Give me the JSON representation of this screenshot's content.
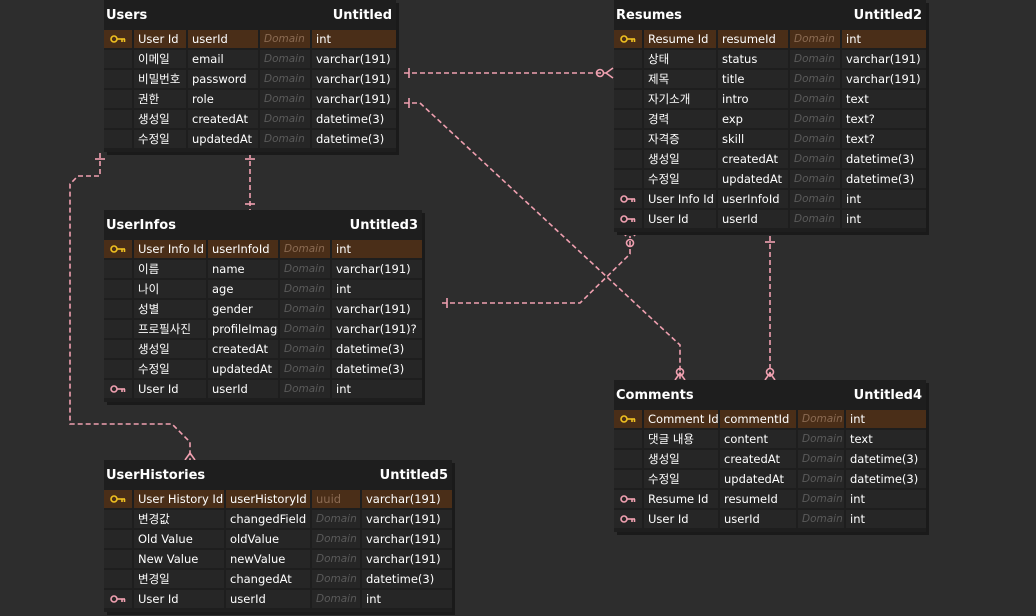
{
  "tables": {
    "users": {
      "name": "Users",
      "alias": "Untitled",
      "rows": [
        {
          "key": "pk",
          "logical": "User Id",
          "physical": "userId",
          "domain": "Domain",
          "type": "int"
        },
        {
          "key": "",
          "logical": "이메일",
          "physical": "email",
          "domain": "Domain",
          "type": "varchar(191)"
        },
        {
          "key": "",
          "logical": "비밀번호",
          "physical": "password",
          "domain": "Domain",
          "type": "varchar(191)"
        },
        {
          "key": "",
          "logical": "권한",
          "physical": "role",
          "domain": "Domain",
          "type": "varchar(191)"
        },
        {
          "key": "",
          "logical": "생성일",
          "physical": "createdAt",
          "domain": "Domain",
          "type": "datetime(3)"
        },
        {
          "key": "",
          "logical": "수정일",
          "physical": "updatedAt",
          "domain": "Domain",
          "type": "datetime(3)"
        }
      ]
    },
    "resumes": {
      "name": "Resumes",
      "alias": "Untitled2",
      "rows": [
        {
          "key": "pk",
          "logical": "Resume Id",
          "physical": "resumeId",
          "domain": "Domain",
          "type": "int"
        },
        {
          "key": "",
          "logical": "상태",
          "physical": "status",
          "domain": "Domain",
          "type": "varchar(191)"
        },
        {
          "key": "",
          "logical": "제목",
          "physical": "title",
          "domain": "Domain",
          "type": "varchar(191)"
        },
        {
          "key": "",
          "logical": "자기소개",
          "physical": "intro",
          "domain": "Domain",
          "type": "text"
        },
        {
          "key": "",
          "logical": "경력",
          "physical": "exp",
          "domain": "Domain",
          "type": "text?"
        },
        {
          "key": "",
          "logical": "자격증",
          "physical": "skill",
          "domain": "Domain",
          "type": "text?"
        },
        {
          "key": "",
          "logical": "생성일",
          "physical": "createdAt",
          "domain": "Domain",
          "type": "datetime(3)"
        },
        {
          "key": "",
          "logical": "수정일",
          "physical": "updatedAt",
          "domain": "Domain",
          "type": "datetime(3)"
        },
        {
          "key": "fk",
          "logical": "User Info Id",
          "physical": "userInfoId",
          "domain": "Domain",
          "type": "int"
        },
        {
          "key": "fk",
          "logical": "User Id",
          "physical": "userId",
          "domain": "Domain",
          "type": "int"
        }
      ]
    },
    "userinfos": {
      "name": "UserInfos",
      "alias": "Untitled3",
      "rows": [
        {
          "key": "pk",
          "logical": "User Info Id",
          "physical": "userInfoId",
          "domain": "Domain",
          "type": "int"
        },
        {
          "key": "",
          "logical": "이름",
          "physical": "name",
          "domain": "Domain",
          "type": "varchar(191)"
        },
        {
          "key": "",
          "logical": "나이",
          "physical": "age",
          "domain": "Domain",
          "type": "int"
        },
        {
          "key": "",
          "logical": "성별",
          "physical": "gender",
          "domain": "Domain",
          "type": "varchar(191)"
        },
        {
          "key": "",
          "logical": "프로필사진",
          "physical": "profileImage",
          "domain": "Domain",
          "type": "varchar(191)?"
        },
        {
          "key": "",
          "logical": "생성일",
          "physical": "createdAt",
          "domain": "Domain",
          "type": "datetime(3)"
        },
        {
          "key": "",
          "logical": "수정일",
          "physical": "updatedAt",
          "domain": "Domain",
          "type": "datetime(3)"
        },
        {
          "key": "fk",
          "logical": "User Id",
          "physical": "userId",
          "domain": "Domain",
          "type": "int"
        }
      ]
    },
    "comments": {
      "name": "Comments",
      "alias": "Untitled4",
      "rows": [
        {
          "key": "pk",
          "logical": "Comment Id",
          "physical": "commentId",
          "domain": "Domain",
          "type": "int"
        },
        {
          "key": "",
          "logical": "댓글 내용",
          "physical": "content",
          "domain": "Domain",
          "type": "text"
        },
        {
          "key": "",
          "logical": "생성일",
          "physical": "createdAt",
          "domain": "Domain",
          "type": "datetime(3)"
        },
        {
          "key": "",
          "logical": "수정일",
          "physical": "updatedAt",
          "domain": "Domain",
          "type": "datetime(3)"
        },
        {
          "key": "fk",
          "logical": "Resume Id",
          "physical": "resumeId",
          "domain": "Domain",
          "type": "int"
        },
        {
          "key": "fk",
          "logical": "User Id",
          "physical": "userId",
          "domain": "Domain",
          "type": "int"
        }
      ]
    },
    "userhistories": {
      "name": "UserHistories",
      "alias": "Untitled5",
      "rows": [
        {
          "key": "pk",
          "logical": "User History Id",
          "physical": "userHistoryId",
          "domain": "uuid",
          "domain_set": true,
          "type": "varchar(191)"
        },
        {
          "key": "",
          "logical": "변경값",
          "physical": "changedField",
          "domain": "Domain",
          "type": "varchar(191)"
        },
        {
          "key": "",
          "logical": "Old Value",
          "physical": "oldValue",
          "domain": "Domain",
          "type": "varchar(191)"
        },
        {
          "key": "",
          "logical": "New Value",
          "physical": "newValue",
          "domain": "Domain",
          "type": "varchar(191)"
        },
        {
          "key": "",
          "logical": "변경일",
          "physical": "changedAt",
          "domain": "Domain",
          "type": "datetime(3)"
        },
        {
          "key": "fk",
          "logical": "User Id",
          "physical": "userId",
          "domain": "Domain",
          "type": "int"
        }
      ]
    }
  },
  "colors": {
    "background": "#2d2d2d",
    "table_bg": "#1e1e1e",
    "cell_bg": "#262626",
    "pk_row_bg": "#4a2e18",
    "pk_key_icon": "#f0c020",
    "fk_key_icon": "#f0a0b0",
    "relationship_line": "#f0a0b0"
  }
}
